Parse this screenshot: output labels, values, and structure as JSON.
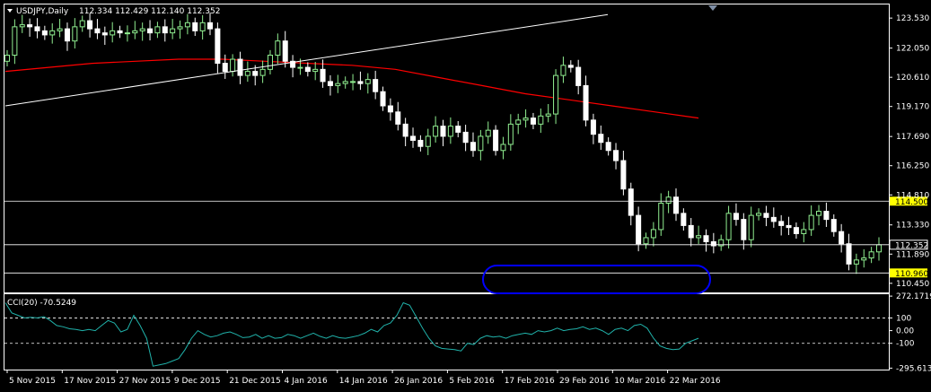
{
  "header": {
    "symbol": "USDJPY,Daily",
    "ohlc": "112.334 112.429 112.140 112.352"
  },
  "indicator": {
    "label": "CCI(20) -70.5249"
  },
  "colors": {
    "background": "#000000",
    "bull": "#90ee90",
    "bear": "#ffffff",
    "ma": "#ff0000",
    "trendline": "#ffffff",
    "cci": "#20b2aa",
    "ellipse": "#0000ff",
    "label_bg": "#ffff00"
  },
  "chart_data": [
    {
      "type": "candlestick",
      "title": "USDJPY,Daily",
      "ylim": [
        110.0,
        124.2
      ],
      "y_ticks": [
        "123.530",
        "122.050",
        "120.610",
        "119.170",
        "117.690",
        "116.250",
        "114.810",
        "113.330",
        "111.890",
        "110.450"
      ],
      "x_ticks": [
        "5 Nov 2015",
        "17 Nov 2015",
        "27 Nov 2015",
        "9 Dec 2015",
        "21 Dec 2015",
        "4 Jan 2016",
        "14 Jan 2016",
        "26 Jan 2016",
        "5 Feb 2016",
        "17 Feb 2016",
        "29 Feb 2016",
        "10 Mar 2016",
        "22 Mar 2016"
      ],
      "close": [
        121.7,
        123.1,
        123.2,
        123.1,
        122.9,
        122.7,
        122.9,
        123.0,
        122.4,
        123.1,
        123.4,
        123.0,
        122.8,
        122.7,
        122.9,
        122.8,
        122.8,
        122.9,
        123.0,
        122.8,
        123.1,
        122.8,
        123.0,
        123.1,
        123.3,
        122.9,
        123.3,
        123.0,
        121.3,
        120.9,
        121.5,
        120.7,
        120.9,
        120.7,
        121.0,
        121.7,
        122.4,
        121.4,
        121.1,
        121.1,
        120.9,
        121.0,
        120.4,
        120.2,
        120.3,
        120.4,
        120.4,
        120.3,
        120.5,
        119.9,
        119.2,
        118.9,
        118.3,
        117.7,
        117.5,
        117.2,
        117.7,
        118.2,
        117.7,
        118.2,
        117.9,
        117.4,
        117.0,
        117.7,
        118.0,
        117.0,
        117.3,
        118.3,
        118.5,
        118.6,
        118.3,
        118.7,
        118.8,
        120.7,
        121.2,
        121.1,
        120.2,
        118.5,
        117.8,
        117.4,
        117.0,
        116.5,
        115.1,
        113.8,
        112.4,
        112.7,
        113.1,
        114.4,
        114.7,
        113.9,
        113.3,
        112.7,
        112.8,
        112.5,
        112.3,
        112.6,
        113.9,
        113.6,
        112.6,
        113.8,
        113.9,
        113.7,
        113.5,
        113.3,
        113.2,
        112.9,
        113.1,
        113.8,
        114.0,
        113.6,
        113.0,
        112.4,
        111.4,
        111.6,
        111.7,
        112.0,
        112.35
      ],
      "ma_series": {
        "values": [
          120.9,
          121.1,
          121.3,
          121.4,
          121.5,
          121.5,
          121.4,
          121.3,
          121.2,
          121.0,
          120.6,
          120.2,
          119.8,
          119.5,
          119.2,
          118.9,
          118.6
        ]
      },
      "trendline": {
        "from": [
          "5 Nov 2015",
          119.2
        ],
        "to": [
          "29 Feb 2016",
          123.7
        ]
      },
      "horizontal_levels": [
        114.5,
        112.352,
        110.96
      ],
      "price_labels": {
        "level_a": "114.500",
        "current": "112.352",
        "level_b": "110.960"
      }
    },
    {
      "type": "line",
      "title": "CCI(20) -70.5249",
      "ylim": [
        -300,
        280
      ],
      "y_ticks": [
        "272.1719",
        "100",
        "0.00",
        "-100",
        "-295.6132"
      ],
      "levels": [
        100,
        -100
      ],
      "values": [
        220,
        140,
        120,
        100,
        105,
        100,
        110,
        80,
        40,
        30,
        15,
        10,
        0,
        10,
        0,
        40,
        80,
        60,
        -10,
        10,
        120,
        40,
        -60,
        -280,
        -270,
        -260,
        -240,
        -220,
        -150,
        -60,
        0,
        -30,
        -50,
        -40,
        -20,
        -10,
        -30,
        -55,
        -50,
        -30,
        -60,
        -40,
        -60,
        -55,
        -30,
        -40,
        -60,
        -40,
        -20,
        -45,
        -60,
        -40,
        -55,
        -60,
        -50,
        -40,
        -20,
        10,
        -10,
        40,
        60,
        120,
        220,
        200,
        110,
        20,
        -60,
        -120,
        -140,
        -145,
        -150,
        -160,
        -100,
        -110,
        -60,
        -40,
        -50,
        -45,
        -60,
        -40,
        -30,
        -20,
        -30,
        0,
        -10,
        0,
        20,
        0,
        10,
        15,
        30,
        10,
        20,
        0,
        -30,
        10,
        20,
        0,
        40,
        50,
        20,
        -60,
        -120,
        -140,
        -150,
        -145,
        -100,
        -80,
        -60
      ]
    }
  ]
}
